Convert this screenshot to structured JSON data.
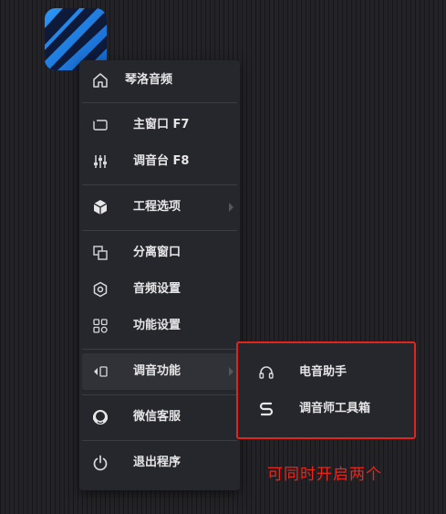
{
  "menu": {
    "header": {
      "label": "琴洛音频",
      "icon": "home-icon"
    },
    "items": [
      {
        "label": "主窗口 F7",
        "icon": "window-icon"
      },
      {
        "label": "调音台 F8",
        "icon": "mixer-sliders-icon"
      },
      {
        "label": "工程选项",
        "icon": "cube-icon",
        "has_submenu": true
      },
      {
        "label": "分离窗口",
        "icon": "detach-window-icon"
      },
      {
        "label": "音频设置",
        "icon": "hex-settings-icon"
      },
      {
        "label": "功能设置",
        "icon": "grid-settings-icon"
      },
      {
        "label": "调音功能",
        "icon": "tuning-icon",
        "has_submenu": true,
        "active": true
      },
      {
        "label": "微信客服",
        "icon": "support-headset-icon"
      },
      {
        "label": "退出程序",
        "icon": "power-icon"
      }
    ]
  },
  "submenu": {
    "items": [
      {
        "label": "电音助手",
        "icon": "headphones-icon"
      },
      {
        "label": "调音师工具箱",
        "icon": "toolbox-icon"
      }
    ]
  },
  "annotation": {
    "text": "可同时开启两个",
    "color": "#e8261b"
  },
  "colors": {
    "menu_bg": "#26272c",
    "text": "#e6e6e8",
    "highlight": "#e0251d",
    "app_icon": "#2c96f5"
  }
}
